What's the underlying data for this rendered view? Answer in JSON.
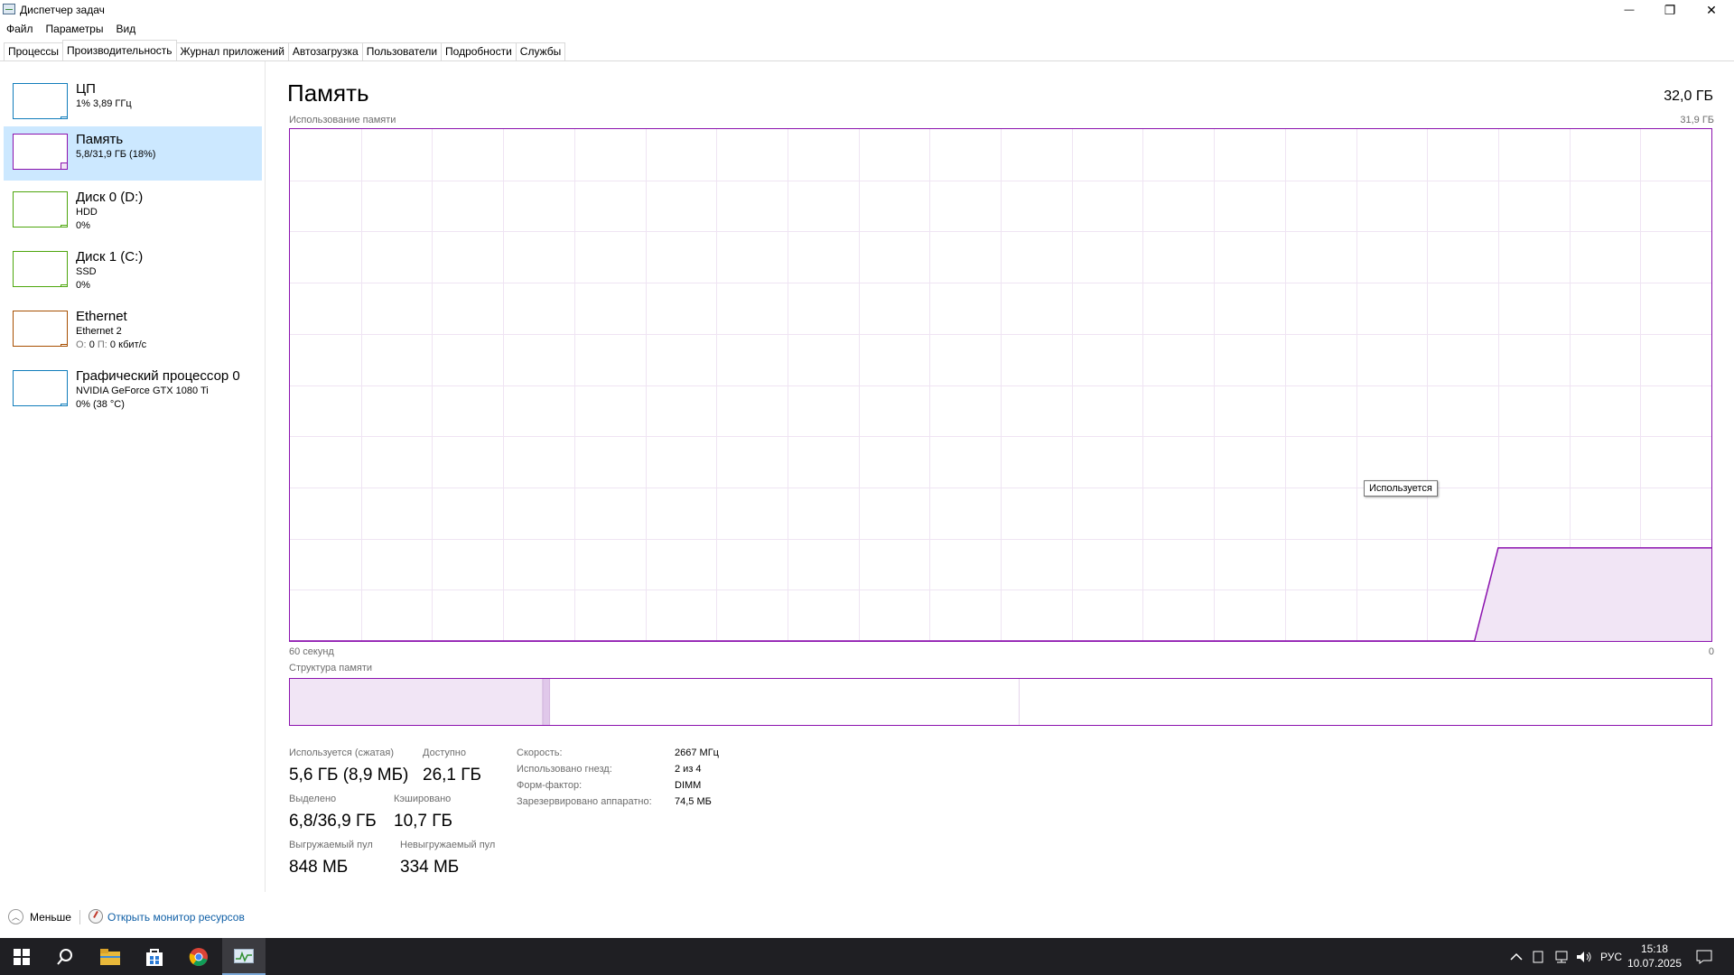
{
  "window": {
    "title": "Диспетчер задач",
    "controls": {
      "minimize": "—",
      "restore": "❐",
      "close": "✕"
    }
  },
  "menu": [
    "Файл",
    "Параметры",
    "Вид"
  ],
  "tabs": [
    "Процессы",
    "Производительность",
    "Журнал приложений",
    "Автозагрузка",
    "Пользователи",
    "Подробности",
    "Службы"
  ],
  "active_tab": "Производительность",
  "sidebar": {
    "items": [
      {
        "title": "ЦП",
        "line1": "1% 3,89 ГГц",
        "line2": "",
        "color": "#117dbb",
        "usage": 0.01
      },
      {
        "title": "Память",
        "line1": "5,8/31,9 ГБ (18%)",
        "line2": "",
        "color": "#8b12ae",
        "usage": 0.18,
        "selected": true
      },
      {
        "title": "Диск 0 (D:)",
        "line1": "HDD",
        "line2": "0%",
        "color": "#4da60c",
        "usage": 0.0
      },
      {
        "title": "Диск 1 (C:)",
        "line1": "SSD",
        "line2": "0%",
        "color": "#4da60c",
        "usage": 0.0
      },
      {
        "title": "Ethernet",
        "line1": "Ethernet 2",
        "line2_label_send": "О:",
        "line2_send": "0",
        "line2_label_recv": "П:",
        "line2_recv": "0 кбит/с",
        "color": "#a74f01",
        "usage": 0.0
      },
      {
        "title": "Графический процессор 0",
        "line1": "NVIDIA GeForce GTX 1080 Ti",
        "line2": "0% (38 °C)",
        "color": "#117dbb",
        "usage": 0.0
      }
    ]
  },
  "main": {
    "title": "Память",
    "total": "32,0 ГБ",
    "usage_label": "Использование памяти",
    "usage_max": "31,9 ГБ",
    "time_left": "60 секунд",
    "time_right": "0",
    "tooltip": "Используется",
    "structure_label": "Структура памяти",
    "accent_color": "#8b12ae",
    "fill_color": "#f1e5f5",
    "grid_color": "#efe4f3"
  },
  "chart_data": {
    "type": "area",
    "title": "Использование памяти",
    "xlabel": "",
    "ylabel": "",
    "x_range_label": [
      "60 секунд",
      "0"
    ],
    "ylim": [
      0,
      31.9
    ],
    "grid": true,
    "series": [
      {
        "name": "Используется",
        "x": [
          -60,
          -10,
          -9,
          0
        ],
        "values": [
          0,
          0,
          5.8,
          5.8
        ]
      }
    ]
  },
  "memory_structure": {
    "in_use_fraction": 0.178,
    "modified_fraction": 0.005,
    "standby_fraction": 0.33,
    "free_fraction": 0.487
  },
  "stats": {
    "in_use_label": "Используется (сжатая)",
    "in_use_value": "5,6 ГБ (8,9 МБ)",
    "available_label": "Доступно",
    "available_value": "26,1 ГБ",
    "committed_label": "Выделено",
    "committed_value": "6,8/36,9 ГБ",
    "cached_label": "Кэшировано",
    "cached_value": "10,7 ГБ",
    "paged_label": "Выгружаемый пул",
    "paged_value": "848 МБ",
    "nonpaged_label": "Невыгружаемый пул",
    "nonpaged_value": "334 МБ"
  },
  "specs": [
    {
      "label": "Скорость:",
      "value": "2667 МГц"
    },
    {
      "label": "Использовано гнезд:",
      "value": "2 из 4"
    },
    {
      "label": "Форм-фактор:",
      "value": "DIMM"
    },
    {
      "label": "Зарезервировано аппаратно:",
      "value": "74,5 МБ"
    }
  ],
  "footer": {
    "less": "Меньше",
    "resource_monitor": "Открыть монитор ресурсов"
  },
  "taskbar": {
    "apps": [
      "start-icon",
      "search-icon",
      "file-explorer-icon",
      "store-icon",
      "chrome-icon",
      "task-manager-icon"
    ],
    "lang": "РУС",
    "time": "15:18",
    "date": "10.07.2025"
  }
}
